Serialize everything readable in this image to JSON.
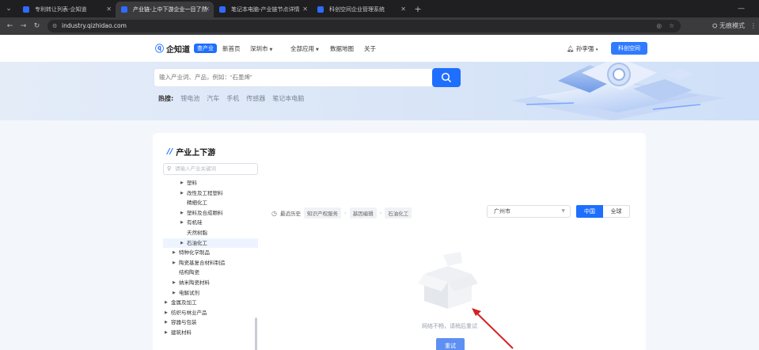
{
  "browser": {
    "tabs": [
      {
        "title": "专利转让列表-企知道",
        "active": false
      },
      {
        "title": "产业链-上中下游企业一目了然",
        "active": true
      },
      {
        "title": "笔记本电脑-产业链节点详情",
        "active": false
      },
      {
        "title": "科创空间企业管理系统",
        "active": false
      }
    ],
    "new_tab": "+",
    "url": "industry.qizhidao.com",
    "profile_label": "无痕模式",
    "minimize": "—",
    "colors": {
      "tabbar": "#1f1f22",
      "toolbar": "#3b3b3e"
    }
  },
  "site": {
    "logo": {
      "name": "企知道",
      "badge": "查产业"
    },
    "nav": [
      {
        "label": "新首页",
        "dropdown": false
      },
      {
        "label": "深圳市",
        "dropdown": true
      },
      {
        "label": "全部应用",
        "dropdown": true
      },
      {
        "label": "数据地图",
        "dropdown": false
      },
      {
        "label": "关于",
        "dropdown": false
      }
    ],
    "user": {
      "name": "孙李强",
      "bell_icon": "bell-icon"
    },
    "cta": "科创空间",
    "search": {
      "placeholder": "输入产业词、产品，例如：“石墨烯”"
    },
    "hot": {
      "label": "热搜:",
      "items": [
        "锂电池",
        "汽车",
        "手机",
        "传感器",
        "笔记本电脑"
      ]
    },
    "accent": "#1f6fff"
  },
  "panel": {
    "title": "产业上下游",
    "tree_search_placeholder": "请输入产业关键词",
    "tree": [
      {
        "label": "塑料",
        "level": 3,
        "arrow": true,
        "selected": false
      },
      {
        "label": "改性及工程塑料",
        "level": 3,
        "arrow": true,
        "selected": false
      },
      {
        "label": "精细化工",
        "level": 3,
        "arrow": false,
        "selected": false
      },
      {
        "label": "塑料及合成颗料",
        "level": 3,
        "arrow": true,
        "selected": false
      },
      {
        "label": "有机硅",
        "level": 3,
        "arrow": true,
        "selected": false
      },
      {
        "label": "天然树脂",
        "level": 3,
        "arrow": false,
        "selected": false
      },
      {
        "label": "石油化工",
        "level": 3,
        "arrow": true,
        "selected": true
      },
      {
        "label": "特种化学制品",
        "level": 2,
        "arrow": true,
        "selected": false
      },
      {
        "label": "陶瓷基复合材料制造",
        "level": 2,
        "arrow": true,
        "selected": false
      },
      {
        "label": "结构陶瓷",
        "level": 2,
        "arrow": false,
        "selected": false
      },
      {
        "label": "纳米陶瓷材料",
        "level": 2,
        "arrow": true,
        "selected": false
      },
      {
        "label": "电解试剂",
        "level": 2,
        "arrow": true,
        "selected": false
      },
      {
        "label": "金属及加工",
        "level": 1,
        "arrow": true,
        "selected": false
      },
      {
        "label": "纺织与林业产品",
        "level": 1,
        "arrow": true,
        "selected": false
      },
      {
        "label": "容器与包装",
        "level": 1,
        "arrow": true,
        "selected": false
      },
      {
        "label": "建筑材料",
        "level": 1,
        "arrow": true,
        "selected": false
      }
    ],
    "history_label": "最近历史",
    "history_items": [
      "知识产权服务",
      "基因编辑",
      "石油化工"
    ],
    "region": "广州市",
    "scope": {
      "active": "中国",
      "inactive": "全球"
    },
    "empty_message": "网络不畅，请稍后重试",
    "retry": "重试"
  }
}
